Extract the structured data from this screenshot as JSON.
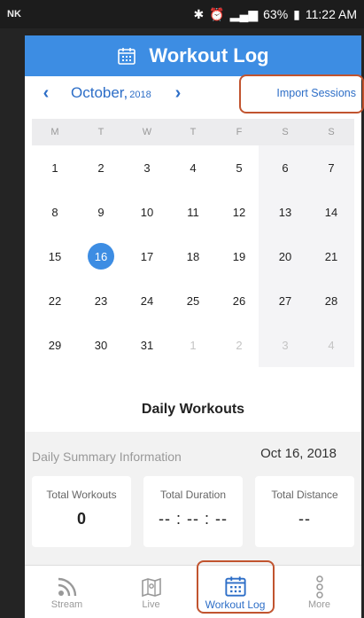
{
  "status_bar": {
    "left_label": "NK",
    "battery": "63%",
    "time": "11:22 AM"
  },
  "header": {
    "title": "Workout Log",
    "icon": "calendar-icon"
  },
  "calendar": {
    "month": "October,",
    "year": "2018",
    "import_label": "Import Sessions",
    "weekdays": [
      "M",
      "T",
      "W",
      "T",
      "F",
      "S",
      "S"
    ],
    "days": [
      "1",
      "2",
      "3",
      "4",
      "5",
      "6",
      "7",
      "8",
      "9",
      "10",
      "11",
      "12",
      "13",
      "14",
      "15",
      "16",
      "17",
      "18",
      "19",
      "20",
      "21",
      "22",
      "23",
      "24",
      "25",
      "26",
      "27",
      "28",
      "29",
      "30",
      "31",
      "1",
      "2",
      "3",
      "4"
    ],
    "selected_day": "16"
  },
  "daily": {
    "title": "Daily Workouts",
    "summary_label": "Daily Summary Information",
    "summary_date": "Oct 16, 2018",
    "stats": [
      {
        "label": "Total Workouts",
        "value": "0"
      },
      {
        "label": "Total Duration",
        "value": "-- : -- : --"
      },
      {
        "label": "Total Distance",
        "value": "--"
      }
    ]
  },
  "nav": [
    {
      "label": "Stream",
      "icon": "rss-icon"
    },
    {
      "label": "Live",
      "icon": "map-icon"
    },
    {
      "label": "Workout Log",
      "icon": "calendar-icon"
    },
    {
      "label": "More",
      "icon": "more-dots-icon"
    }
  ],
  "colors": {
    "accent": "#3d8de3",
    "highlight": "#c1542f"
  }
}
